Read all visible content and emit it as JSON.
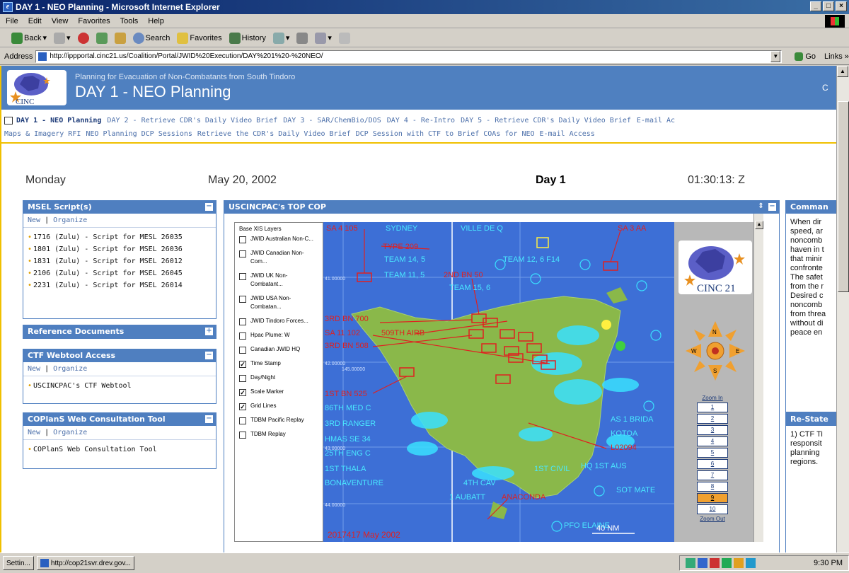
{
  "window": {
    "title": "DAY 1 - NEO Planning - Microsoft Internet Explorer"
  },
  "menu": [
    "File",
    "Edit",
    "View",
    "Favorites",
    "Tools",
    "Help"
  ],
  "toolbar": {
    "back": "Back",
    "search": "Search",
    "favorites": "Favorites",
    "history": "History"
  },
  "address": {
    "label": "Address",
    "url": "http://ippportal.cinc21.us/Coalition/Portal/JWID%20Execution/DAY%201%20-%20NEO/",
    "go": "Go",
    "links": "Links »"
  },
  "banner": {
    "subtitle": "Planning for Evacuation of Non-Combatants from South Tindoro",
    "title": "DAY 1 - NEO Planning",
    "logo_text": "CINC",
    "right_char": "C"
  },
  "nav": {
    "current": "DAY 1 - NEO Planning",
    "row1": [
      "DAY 2 - Retrieve CDR's Daily Video Brief",
      "DAY 3 - SAR/ChemBio/DOS",
      "DAY 4 - Re-Intro",
      "DAY 5 - Retrieve CDR's Daily Video Brief",
      "E-mail Ac"
    ],
    "row2": [
      "Maps & Imagery RFI",
      "NEO Planning DCP Sessions",
      "Retrieve the CDR's Daily Video Brief",
      "DCP Session with CTF to Brief COAs for NEO",
      "E-mail Access"
    ]
  },
  "dateline": {
    "weekday": "Monday",
    "date": "May 20, 2002",
    "day": "Day 1",
    "time": "01:30:13: Z"
  },
  "portlets": {
    "msel": {
      "title": "MSEL Script(s)",
      "new": "New",
      "organize": "Organize",
      "items": [
        "1716 (Zulu) - Script for MESL 26035",
        "1801 (Zulu) - Script for MSEL 26036",
        "1831 (Zulu) - Script for MSEL 26012",
        "2106 (Zulu) - Script for MSEL 26045",
        "2231 (Zulu) - Script for MSEL 26014"
      ]
    },
    "refdocs": {
      "title": "Reference Documents"
    },
    "ctf": {
      "title": "CTF Webtool Access",
      "new": "New",
      "organize": "Organize",
      "items": [
        "USCINCPAC's CTF Webtool"
      ]
    },
    "coplans": {
      "title": "COPlanS Web Consultation Tool",
      "new": "New",
      "organize": "Organize",
      "items": [
        "COPlanS Web Consultation Tool"
      ]
    },
    "cop": {
      "title": "USCINCPAC's TOP COP"
    },
    "command": {
      "title": "Comman",
      "lines": [
        "When dir",
        "speed, ar",
        "noncomb",
        "haven in t",
        "that minir",
        "confronte",
        "The safet",
        "from the r",
        "Desired c",
        "noncomb",
        "from threa",
        "without di",
        "peace en"
      ]
    },
    "restate": {
      "title": "Re-State",
      "lines": [
        "1) CTF Ti",
        "responsit",
        "planning",
        "regions."
      ]
    }
  },
  "layers": {
    "heading": "Base XIS Layers",
    "items": [
      {
        "label": "JWID Australian Non-C...",
        "checked": false
      },
      {
        "label": "JWID Canadian Non-Com...",
        "checked": false
      },
      {
        "label": "JWID UK Non-Combatant...",
        "checked": false
      },
      {
        "label": "JWID USA Non-Combatan...",
        "checked": false
      },
      {
        "label": "JWID Tindoro Forces...",
        "checked": false
      },
      {
        "label": "Hpac Plume: W",
        "checked": false
      },
      {
        "label": "Canadian JWID HQ",
        "checked": false
      },
      {
        "label": "Time Stamp",
        "checked": true
      },
      {
        "label": "Day/Night",
        "checked": false
      },
      {
        "label": "Scale Marker",
        "checked": true
      },
      {
        "label": "Grid Lines",
        "checked": true
      },
      {
        "label": "TDBM Pacific Replay",
        "checked": false
      },
      {
        "label": "TDBM Replay",
        "checked": false
      }
    ]
  },
  "map": {
    "labels_red": [
      {
        "t": "SA 4 105"
      },
      {
        "t": "TYPE 209"
      },
      {
        "t": "2ND BN 50"
      },
      {
        "t": "SA 3 AA"
      },
      {
        "t": "3RD BN 700"
      },
      {
        "t": "SA 11 102"
      },
      {
        "t": "509TH AIRB"
      },
      {
        "t": "3RD BN 508"
      },
      {
        "t": "1ST BN 525"
      },
      {
        "t": "L02094"
      },
      {
        "t": "ANACONDA"
      }
    ],
    "labels_blue": [
      {
        "t": "SYDNEY"
      },
      {
        "t": "VILLE DE Q"
      },
      {
        "t": "TEAM 14, 5"
      },
      {
        "t": "TEAM 12, 6 F14"
      },
      {
        "t": "TEAM 11, 5"
      },
      {
        "t": "TEAM 15, 6"
      },
      {
        "t": "86TH MED C"
      },
      {
        "t": "3RD RANGER"
      },
      {
        "t": "HMAS SE 34"
      },
      {
        "t": "25TH ENG C"
      },
      {
        "t": "1ST THALA"
      },
      {
        "t": "BONAVENTURE"
      },
      {
        "t": "4TH CAV"
      },
      {
        "t": "1 AUBATT"
      },
      {
        "t": "AS 1 BRIDA"
      },
      {
        "t": "KOTOA"
      },
      {
        "t": "HQ 1ST AUS"
      },
      {
        "t": "1ST CIVIL"
      },
      {
        "t": "SOT MATE"
      },
      {
        "t": "PFO ELAINE"
      }
    ],
    "grid_labels": [
      "41.00000",
      "42.00000",
      "43.00000",
      "44.00000",
      "145.00000"
    ],
    "timestamp": "2017417 May 2002",
    "scale": "40 NM",
    "logo_text": "CINC 21",
    "compass": {
      "n": "N",
      "s": "S",
      "e": "E",
      "w": "W"
    },
    "zoom_in": "Zoom In",
    "zoom_out": "Zoom Out",
    "zoom_levels": [
      "1",
      "2",
      "3",
      "4",
      "5",
      "6",
      "7",
      "8",
      "9",
      "10"
    ],
    "zoom_active": "9"
  },
  "statusbar": {
    "start": "Settin...",
    "task": "http://cop21svr.drev.gov...",
    "clock": "9:30 PM"
  }
}
